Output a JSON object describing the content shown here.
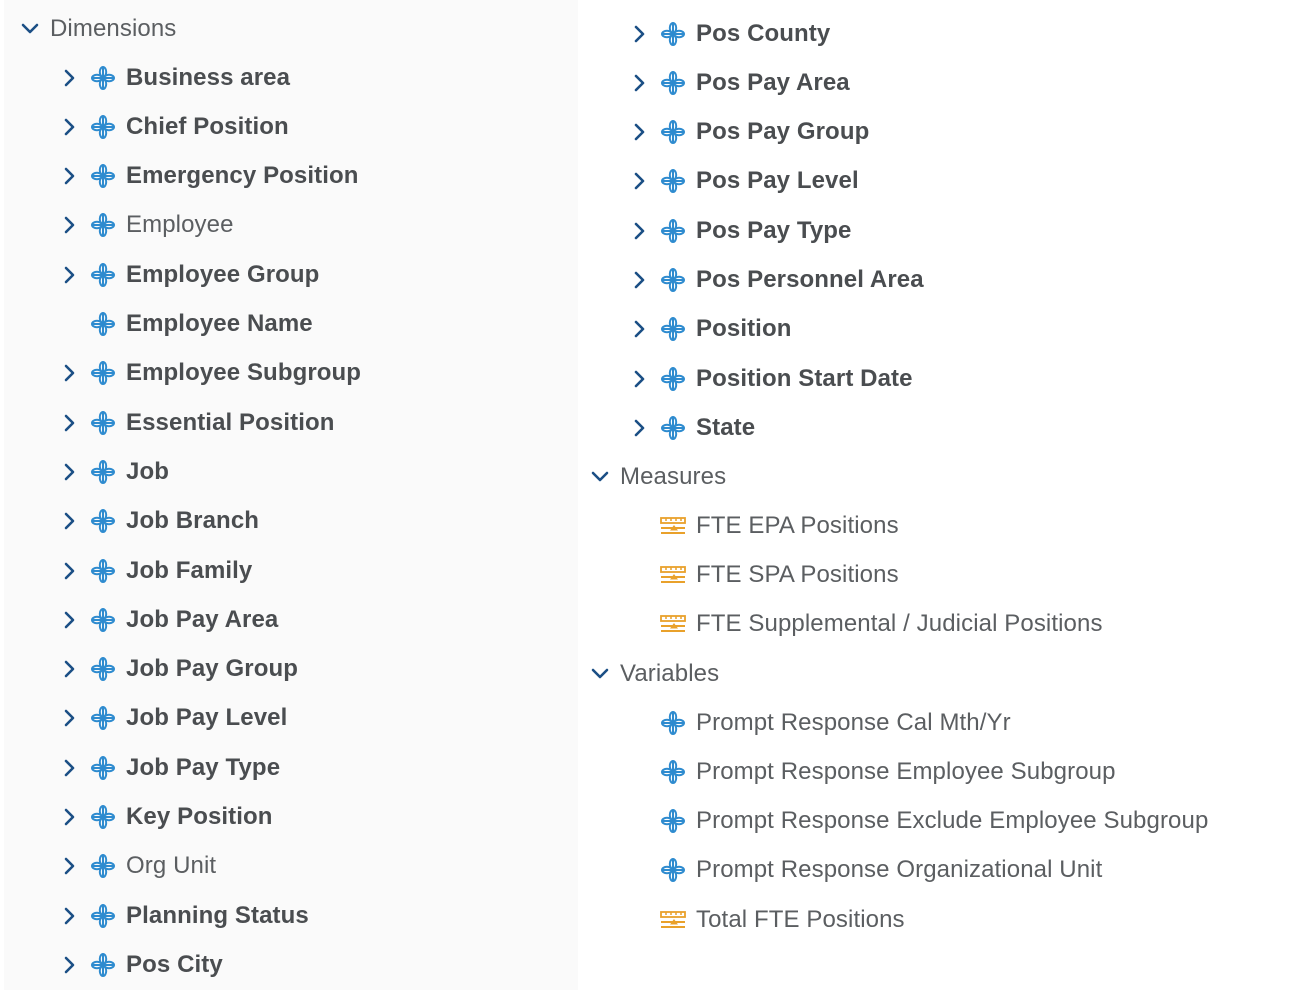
{
  "colors": {
    "chevron": "#1b4f85",
    "dimension_icon": "#2e8bcf",
    "measure_icon": "#e9a12b",
    "text_bold": "#4a4d50",
    "text_normal": "#5b5e61"
  },
  "dimensions": {
    "label": "Dimensions",
    "expanded": true,
    "items": [
      {
        "label": "Business area",
        "bold": true,
        "expandable": true,
        "icon": "dimension-icon"
      },
      {
        "label": "Chief Position",
        "bold": true,
        "expandable": true,
        "icon": "dimension-icon"
      },
      {
        "label": "Emergency Position",
        "bold": true,
        "expandable": true,
        "icon": "dimension-icon"
      },
      {
        "label": "Employee",
        "bold": false,
        "expandable": true,
        "icon": "dimension-icon"
      },
      {
        "label": "Employee Group",
        "bold": true,
        "expandable": true,
        "icon": "dimension-icon"
      },
      {
        "label": "Employee Name",
        "bold": true,
        "expandable": false,
        "icon": "dimension-icon"
      },
      {
        "label": "Employee Subgroup",
        "bold": true,
        "expandable": true,
        "icon": "dimension-icon"
      },
      {
        "label": "Essential Position",
        "bold": true,
        "expandable": true,
        "icon": "dimension-icon"
      },
      {
        "label": "Job",
        "bold": true,
        "expandable": true,
        "icon": "dimension-icon"
      },
      {
        "label": "Job Branch",
        "bold": true,
        "expandable": true,
        "icon": "dimension-icon"
      },
      {
        "label": "Job Family",
        "bold": true,
        "expandable": true,
        "icon": "dimension-icon"
      },
      {
        "label": "Job Pay Area",
        "bold": true,
        "expandable": true,
        "icon": "dimension-icon"
      },
      {
        "label": "Job Pay Group",
        "bold": true,
        "expandable": true,
        "icon": "dimension-icon"
      },
      {
        "label": "Job Pay Level",
        "bold": true,
        "expandable": true,
        "icon": "dimension-icon"
      },
      {
        "label": "Job Pay Type",
        "bold": true,
        "expandable": true,
        "icon": "dimension-icon"
      },
      {
        "label": "Key Position",
        "bold": true,
        "expandable": true,
        "icon": "dimension-icon"
      },
      {
        "label": "Org Unit",
        "bold": false,
        "expandable": true,
        "icon": "dimension-icon"
      },
      {
        "label": "Planning Status",
        "bold": true,
        "expandable": true,
        "icon": "dimension-icon"
      },
      {
        "label": "Pos City",
        "bold": true,
        "expandable": true,
        "icon": "dimension-icon"
      },
      {
        "label": "Pos County",
        "bold": true,
        "expandable": true,
        "icon": "dimension-icon"
      },
      {
        "label": "Pos Pay Area",
        "bold": true,
        "expandable": true,
        "icon": "dimension-icon"
      },
      {
        "label": "Pos Pay Group",
        "bold": true,
        "expandable": true,
        "icon": "dimension-icon"
      },
      {
        "label": "Pos Pay Level",
        "bold": true,
        "expandable": true,
        "icon": "dimension-icon"
      },
      {
        "label": "Pos Pay Type",
        "bold": true,
        "expandable": true,
        "icon": "dimension-icon"
      },
      {
        "label": "Pos Personnel Area",
        "bold": true,
        "expandable": true,
        "icon": "dimension-icon"
      },
      {
        "label": "Position",
        "bold": true,
        "expandable": true,
        "icon": "dimension-icon"
      },
      {
        "label": "Position Start Date",
        "bold": true,
        "expandable": true,
        "icon": "dimension-icon"
      },
      {
        "label": "State",
        "bold": true,
        "expandable": true,
        "icon": "dimension-icon"
      }
    ]
  },
  "measures": {
    "label": "Measures",
    "expanded": true,
    "items": [
      {
        "label": "FTE EPA Positions",
        "icon": "measure-icon"
      },
      {
        "label": "FTE SPA Positions",
        "icon": "measure-icon"
      },
      {
        "label": "FTE Supplemental / Judicial Positions",
        "icon": "measure-icon"
      }
    ]
  },
  "variables": {
    "label": "Variables",
    "expanded": true,
    "items": [
      {
        "label": "Prompt Response Cal Mth/Yr",
        "icon": "dimension-icon"
      },
      {
        "label": "Prompt Response Employee Subgroup",
        "icon": "dimension-icon"
      },
      {
        "label": "Prompt Response Exclude Employee Subgroup",
        "icon": "dimension-icon"
      },
      {
        "label": "Prompt Response Organizational Unit",
        "icon": "dimension-icon"
      },
      {
        "label": "Total FTE Positions",
        "icon": "measure-icon"
      }
    ]
  }
}
